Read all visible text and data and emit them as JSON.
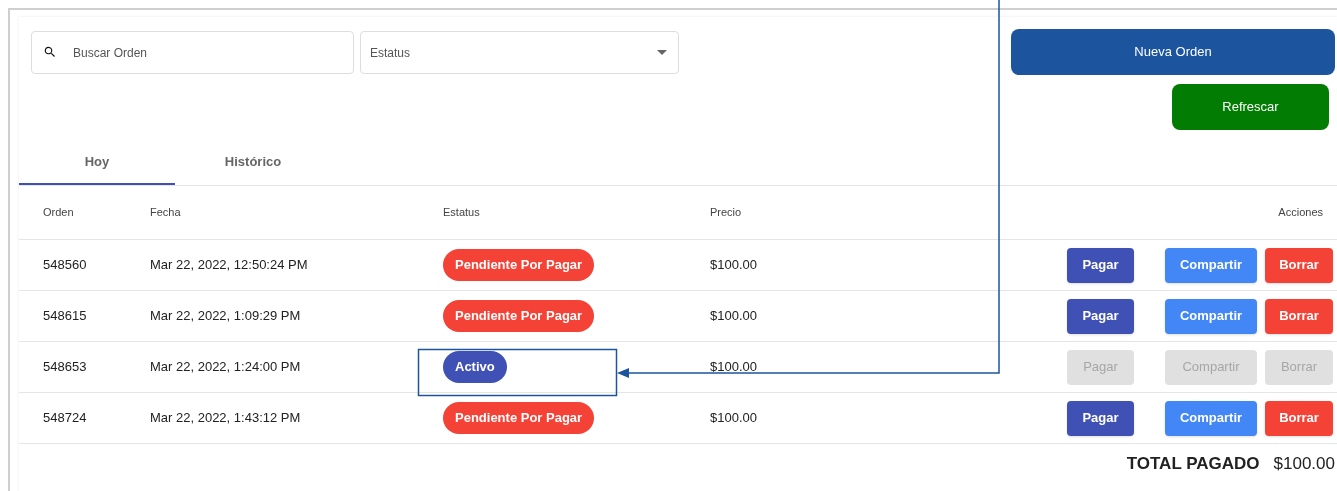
{
  "search": {
    "placeholder": "Buscar Orden"
  },
  "status_filter": {
    "placeholder": "Estatus"
  },
  "buttons": [
    {
      "kind": "new",
      "label": "Nueva Orden"
    },
    {
      "kind": "refresh",
      "label": "Refrescar"
    }
  ],
  "tabs": [
    {
      "label": "Hoy",
      "selected": true
    },
    {
      "label": "Histórico",
      "selected": false
    }
  ],
  "table": {
    "columns": [
      "Orden",
      "Fecha",
      "Estatus",
      "Precio",
      "Acciones"
    ],
    "rows": [
      {
        "order": "548560",
        "date": "Mar 22, 2022, 12:50:24 PM",
        "status": {
          "kind": "pending",
          "label": "Pendiente Por Pagar"
        },
        "price": "$100.00",
        "actions": [
          {
            "kind": "pay",
            "label": "Pagar",
            "disabled": false
          },
          {
            "kind": "share",
            "label": "Compartir",
            "disabled": false
          },
          {
            "kind": "delete",
            "label": "Borrar",
            "disabled": false
          }
        ]
      },
      {
        "order": "548615",
        "date": "Mar 22, 2022, 1:09:29 PM",
        "status": {
          "kind": "pending",
          "label": "Pendiente Por Pagar"
        },
        "price": "$100.00",
        "actions": [
          {
            "kind": "pay",
            "label": "Pagar",
            "disabled": false
          },
          {
            "kind": "share",
            "label": "Compartir",
            "disabled": false
          },
          {
            "kind": "delete",
            "label": "Borrar",
            "disabled": false
          }
        ]
      },
      {
        "order": "548653",
        "date": "Mar 22, 2022, 1:24:00 PM",
        "status": {
          "kind": "active",
          "label": "Activo"
        },
        "price": "$100.00",
        "actions": [
          {
            "kind": "pay",
            "label": "Pagar",
            "disabled": true
          },
          {
            "kind": "share",
            "label": "Compartir",
            "disabled": true
          },
          {
            "kind": "delete",
            "label": "Borrar",
            "disabled": true
          }
        ]
      },
      {
        "order": "548724",
        "date": "Mar 22, 2022, 1:43:12 PM",
        "status": {
          "kind": "pending",
          "label": "Pendiente Por Pagar"
        },
        "price": "$100.00",
        "actions": [
          {
            "kind": "pay",
            "label": "Pagar",
            "disabled": false
          },
          {
            "kind": "share",
            "label": "Compartir",
            "disabled": false
          },
          {
            "kind": "delete",
            "label": "Borrar",
            "disabled": false
          }
        ]
      }
    ]
  },
  "total": {
    "label": "TOTAL PAGADO",
    "value": "$100.00"
  }
}
